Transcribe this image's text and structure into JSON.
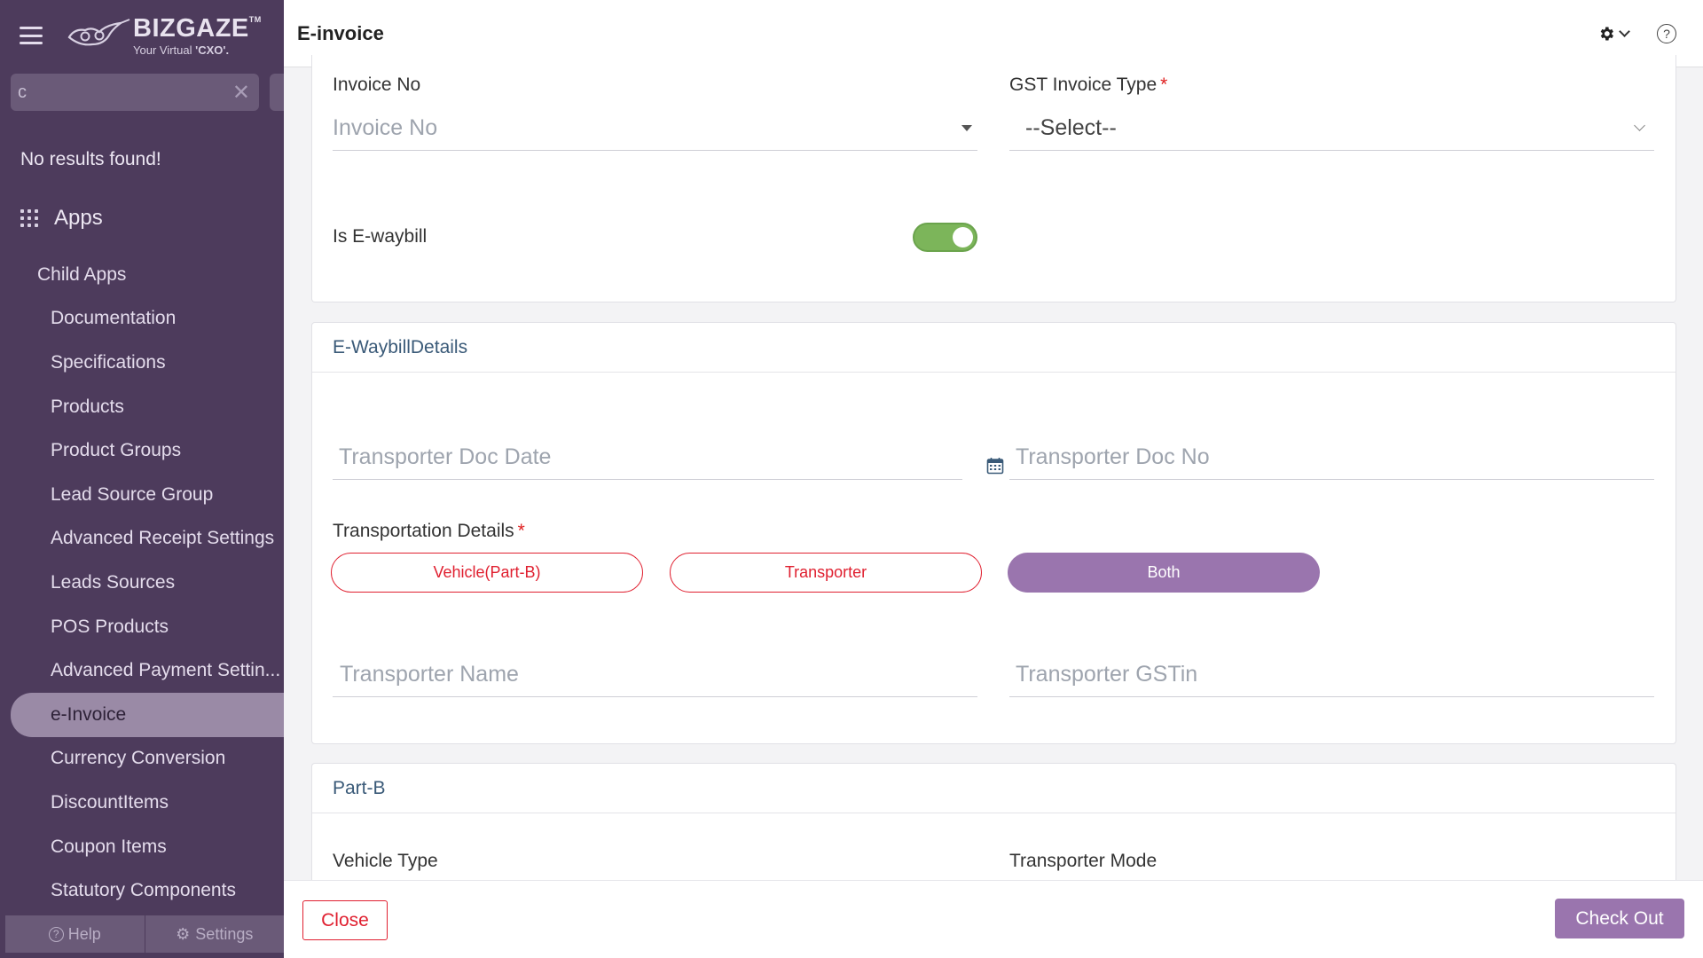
{
  "sidebar": {
    "brand": "BIZGAZE",
    "trademark": "TM",
    "tagline_prefix": "Your Virtual ",
    "tagline_bold": "'CXO'.",
    "search_value": "c",
    "no_results": "No results found!",
    "apps_label": "Apps",
    "items": [
      {
        "label": "Child Apps"
      },
      {
        "label": "Documentation"
      },
      {
        "label": "Specifications"
      },
      {
        "label": "Products"
      },
      {
        "label": "Product Groups"
      },
      {
        "label": "Lead Source Group"
      },
      {
        "label": "Advanced Receipt Settings"
      },
      {
        "label": "Leads Sources"
      },
      {
        "label": "POS Products"
      },
      {
        "label": "Advanced Payment Settin..."
      },
      {
        "label": "e-Invoice"
      },
      {
        "label": "Currency Conversion"
      },
      {
        "label": "DiscountItems"
      },
      {
        "label": "Coupon Items"
      },
      {
        "label": "Statutory Components"
      }
    ],
    "footer": {
      "help": "Help",
      "settings": "Settings"
    }
  },
  "header": {
    "title": "E-invoice"
  },
  "invoice_section": {
    "invoice_no_label": "Invoice No",
    "invoice_no_placeholder": "Invoice No",
    "gst_type_label": "GST Invoice Type",
    "gst_type_value": "--Select--",
    "ewaybill_label": "Is E-waybill",
    "ewaybill_on": true
  },
  "ewaybill_section": {
    "title": "E-WaybillDetails",
    "doc_date_placeholder": "Transporter Doc Date",
    "doc_no_placeholder": "Transporter Doc No",
    "transport_details_label": "Transportation Details",
    "options": [
      "Vehicle(Part-B)",
      "Transporter",
      "Both"
    ],
    "selected_option": "Both",
    "transporter_name_placeholder": "Transporter Name",
    "transporter_gstin_placeholder": "Transporter GSTin"
  },
  "partb_section": {
    "title": "Part-B",
    "vehicle_type_label": "Vehicle Type",
    "transporter_mode_label": "Transporter Mode"
  },
  "footer": {
    "close": "Close",
    "checkout": "Check Out"
  },
  "colors": {
    "sidebar": "#4d3b5c",
    "accent": "#9a75ae",
    "danger": "#e02030",
    "toggle": "#7cb55a"
  }
}
